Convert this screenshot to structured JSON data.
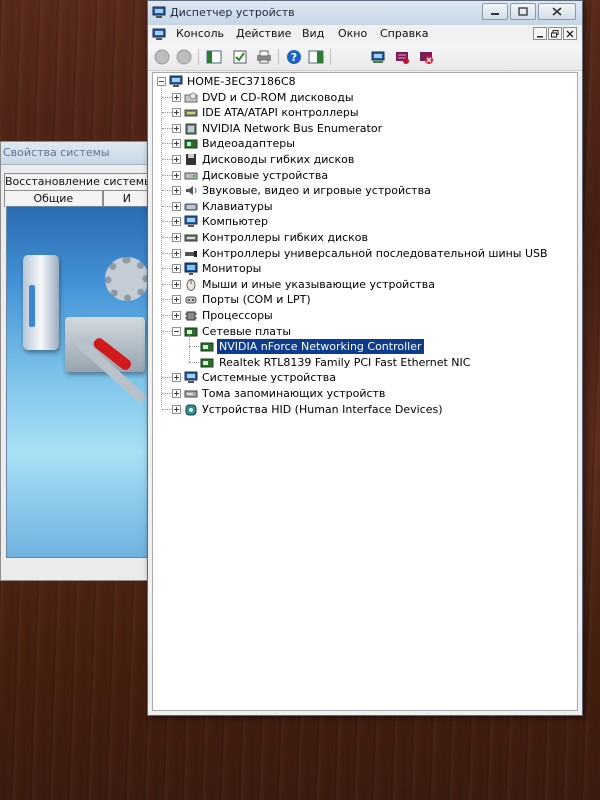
{
  "background_window": {
    "title": "Свойства системы",
    "tabs_row1": [
      "Восстановление системы"
    ],
    "tabs_row2": [
      "Общие",
      "И"
    ]
  },
  "device_manager": {
    "title": "Диспетчер устройств",
    "menu": [
      "Консоль",
      "Действие",
      "Вид",
      "Окно",
      "Справка"
    ],
    "toolbar_icons": [
      "back-icon",
      "forward-icon",
      "properties-icon",
      "refresh-icon",
      "print-icon",
      "help-icon",
      "console-tree-icon",
      "scan-hardware-icon",
      "update-driver-icon",
      "disable-device-icon",
      "uninstall-icon"
    ],
    "tree": {
      "root": "HOME-3EC37186C8",
      "categories": [
        {
          "label": "DVD и CD-ROM дисководы",
          "icon": "dvd-drive-icon"
        },
        {
          "label": "IDE ATA/ATAPI контроллеры",
          "icon": "ide-controller-icon"
        },
        {
          "label": "NVIDIA Network Bus Enumerator",
          "icon": "bus-enumerator-icon"
        },
        {
          "label": "Видеоадаптеры",
          "icon": "display-adapter-icon"
        },
        {
          "label": "Дисководы гибких дисков",
          "icon": "floppy-drive-icon"
        },
        {
          "label": "Дисковые устройства",
          "icon": "disk-drive-icon"
        },
        {
          "label": "Звуковые, видео и игровые устройства",
          "icon": "sound-device-icon"
        },
        {
          "label": "Клавиатуры",
          "icon": "keyboard-icon"
        },
        {
          "label": "Компьютер",
          "icon": "computer-icon"
        },
        {
          "label": "Контроллеры гибких дисков",
          "icon": "floppy-controller-icon"
        },
        {
          "label": "Контроллеры универсальной последовательной шины USB",
          "icon": "usb-controller-icon"
        },
        {
          "label": "Мониторы",
          "icon": "monitor-icon"
        },
        {
          "label": "Мыши и иные указывающие устройства",
          "icon": "mouse-icon"
        },
        {
          "label": "Порты (COM и LPT)",
          "icon": "port-icon"
        },
        {
          "label": "Процессоры",
          "icon": "processor-icon"
        },
        {
          "label": "Сетевые платы",
          "icon": "network-adapter-icon",
          "expanded": true,
          "children": [
            {
              "label": "NVIDIA nForce Networking Controller",
              "selected": true
            },
            {
              "label": "Realtek RTL8139 Family PCI Fast Ethernet NIC",
              "selected": false
            }
          ]
        },
        {
          "label": "Системные устройства",
          "icon": "system-device-icon"
        },
        {
          "label": "Тома запоминающих устройств",
          "icon": "storage-volume-icon"
        },
        {
          "label": "Устройства HID (Human Interface Devices)",
          "icon": "hid-icon"
        }
      ]
    }
  },
  "colors": {
    "selection": "#0d3c8c",
    "desktop": "#4a1f14",
    "titlebar": "#c6d6e7"
  }
}
